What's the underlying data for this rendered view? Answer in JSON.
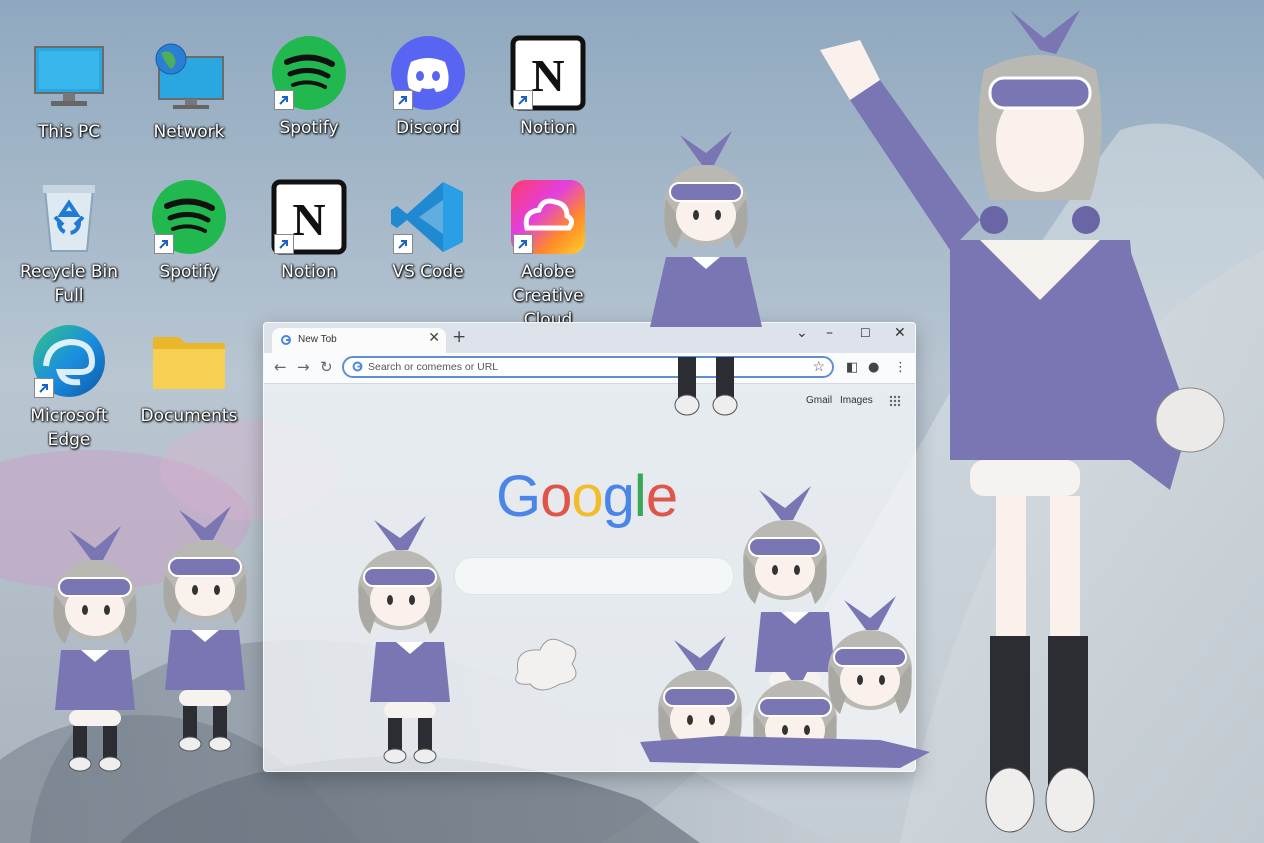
{
  "desktop": {
    "icons": [
      {
        "label": "This PC",
        "icon": "this-pc-icon"
      },
      {
        "label": "Network",
        "icon": "network-icon"
      },
      {
        "label": "Spotify",
        "icon": "spotify-icon"
      },
      {
        "label": "Discord",
        "icon": "discord-icon"
      },
      {
        "label": "Notion",
        "icon": "notion-icon"
      },
      {
        "label": "Recycle Bin Full",
        "icon": "recycle-bin-icon"
      },
      {
        "label": "Spotify",
        "icon": "spotify-icon"
      },
      {
        "label": "Notion",
        "icon": "notion-icon"
      },
      {
        "label": "VS Code",
        "icon": "vscode-icon"
      },
      {
        "label": "Adobe Creative Cloud",
        "icon": "adobe-cc-icon"
      },
      {
        "label": "Microsoft Edge",
        "icon": "edge-icon"
      },
      {
        "label": "Documents",
        "icon": "folder-icon"
      }
    ]
  },
  "browser": {
    "tab_title": "New Tob",
    "tab_close": "✕",
    "new_tab": "+",
    "omnibox_placeholder": "Search or comemes or URL",
    "links": {
      "gmail": "Gmail",
      "images": "Images"
    },
    "logo": {
      "G": "G",
      "o1": "o",
      "o2": "o",
      "g": "g",
      "l": "l",
      "e": "e"
    }
  },
  "colors": {
    "google_blue": "#4a86e8",
    "google_red": "#e0554a",
    "google_yellow": "#f2bd2a",
    "google_green": "#3aa757",
    "character_purple": "#7a76b4"
  }
}
